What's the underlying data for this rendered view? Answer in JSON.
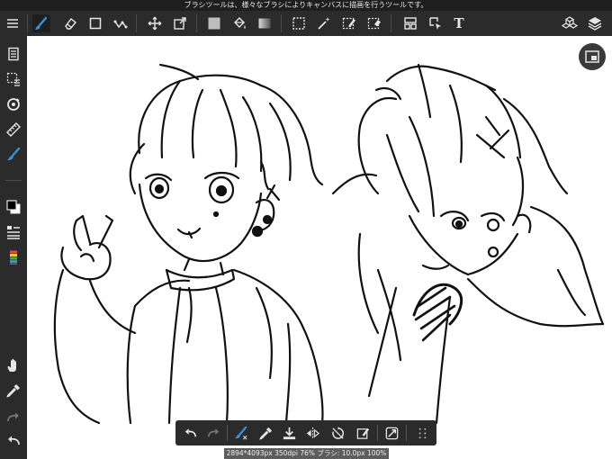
{
  "tip_bar": {
    "text": "ブラシツールは、様々なブラシによりキャンバスに描画を行うツールです。"
  },
  "top_toolbar": {
    "icons": [
      "menu-icon",
      "brush-icon",
      "eraser-icon",
      "rectangle-icon",
      "transform-icon",
      "move-icon",
      "canvas-transform-icon",
      "fill-color-icon",
      "bucket-icon",
      "gradient-icon",
      "select-icon",
      "magic-wand-icon",
      "select-pen-icon",
      "select-eraser-icon",
      "frame-divider-icon",
      "operation-icon",
      "text-icon",
      "materials-icon",
      "layers-icon"
    ],
    "text_tool_label": "T",
    "accent": "#3d8fd6"
  },
  "left_toolbar": {
    "icons": [
      "page-manager-icon",
      "selection-dashed-icon",
      "snap-icon",
      "ruler-icon",
      "brush-cursor-icon",
      "color-swatch-icon",
      "brush-size-icon",
      "color-palette-icon",
      "hand-icon",
      "eyedropper-icon",
      "redo-icon",
      "undo-icon"
    ]
  },
  "bottom_toolbar": {
    "icons": [
      "undo-icon",
      "redo-icon",
      "brush-tool-icon",
      "eyedropper-icon",
      "save-icon",
      "flip-icon",
      "rotate-icon",
      "edit-icon",
      "toggle-icon",
      "grid-icon"
    ]
  },
  "status_bar": {
    "text": "2894*4093px 350dpi 76% ブラシ: 10.0px 100%"
  },
  "colors": {
    "toolbar_bg": "#2b2b2b",
    "icon": "#e6e6e6",
    "accent": "#3d8fd6",
    "canvas": "#ffffff"
  }
}
